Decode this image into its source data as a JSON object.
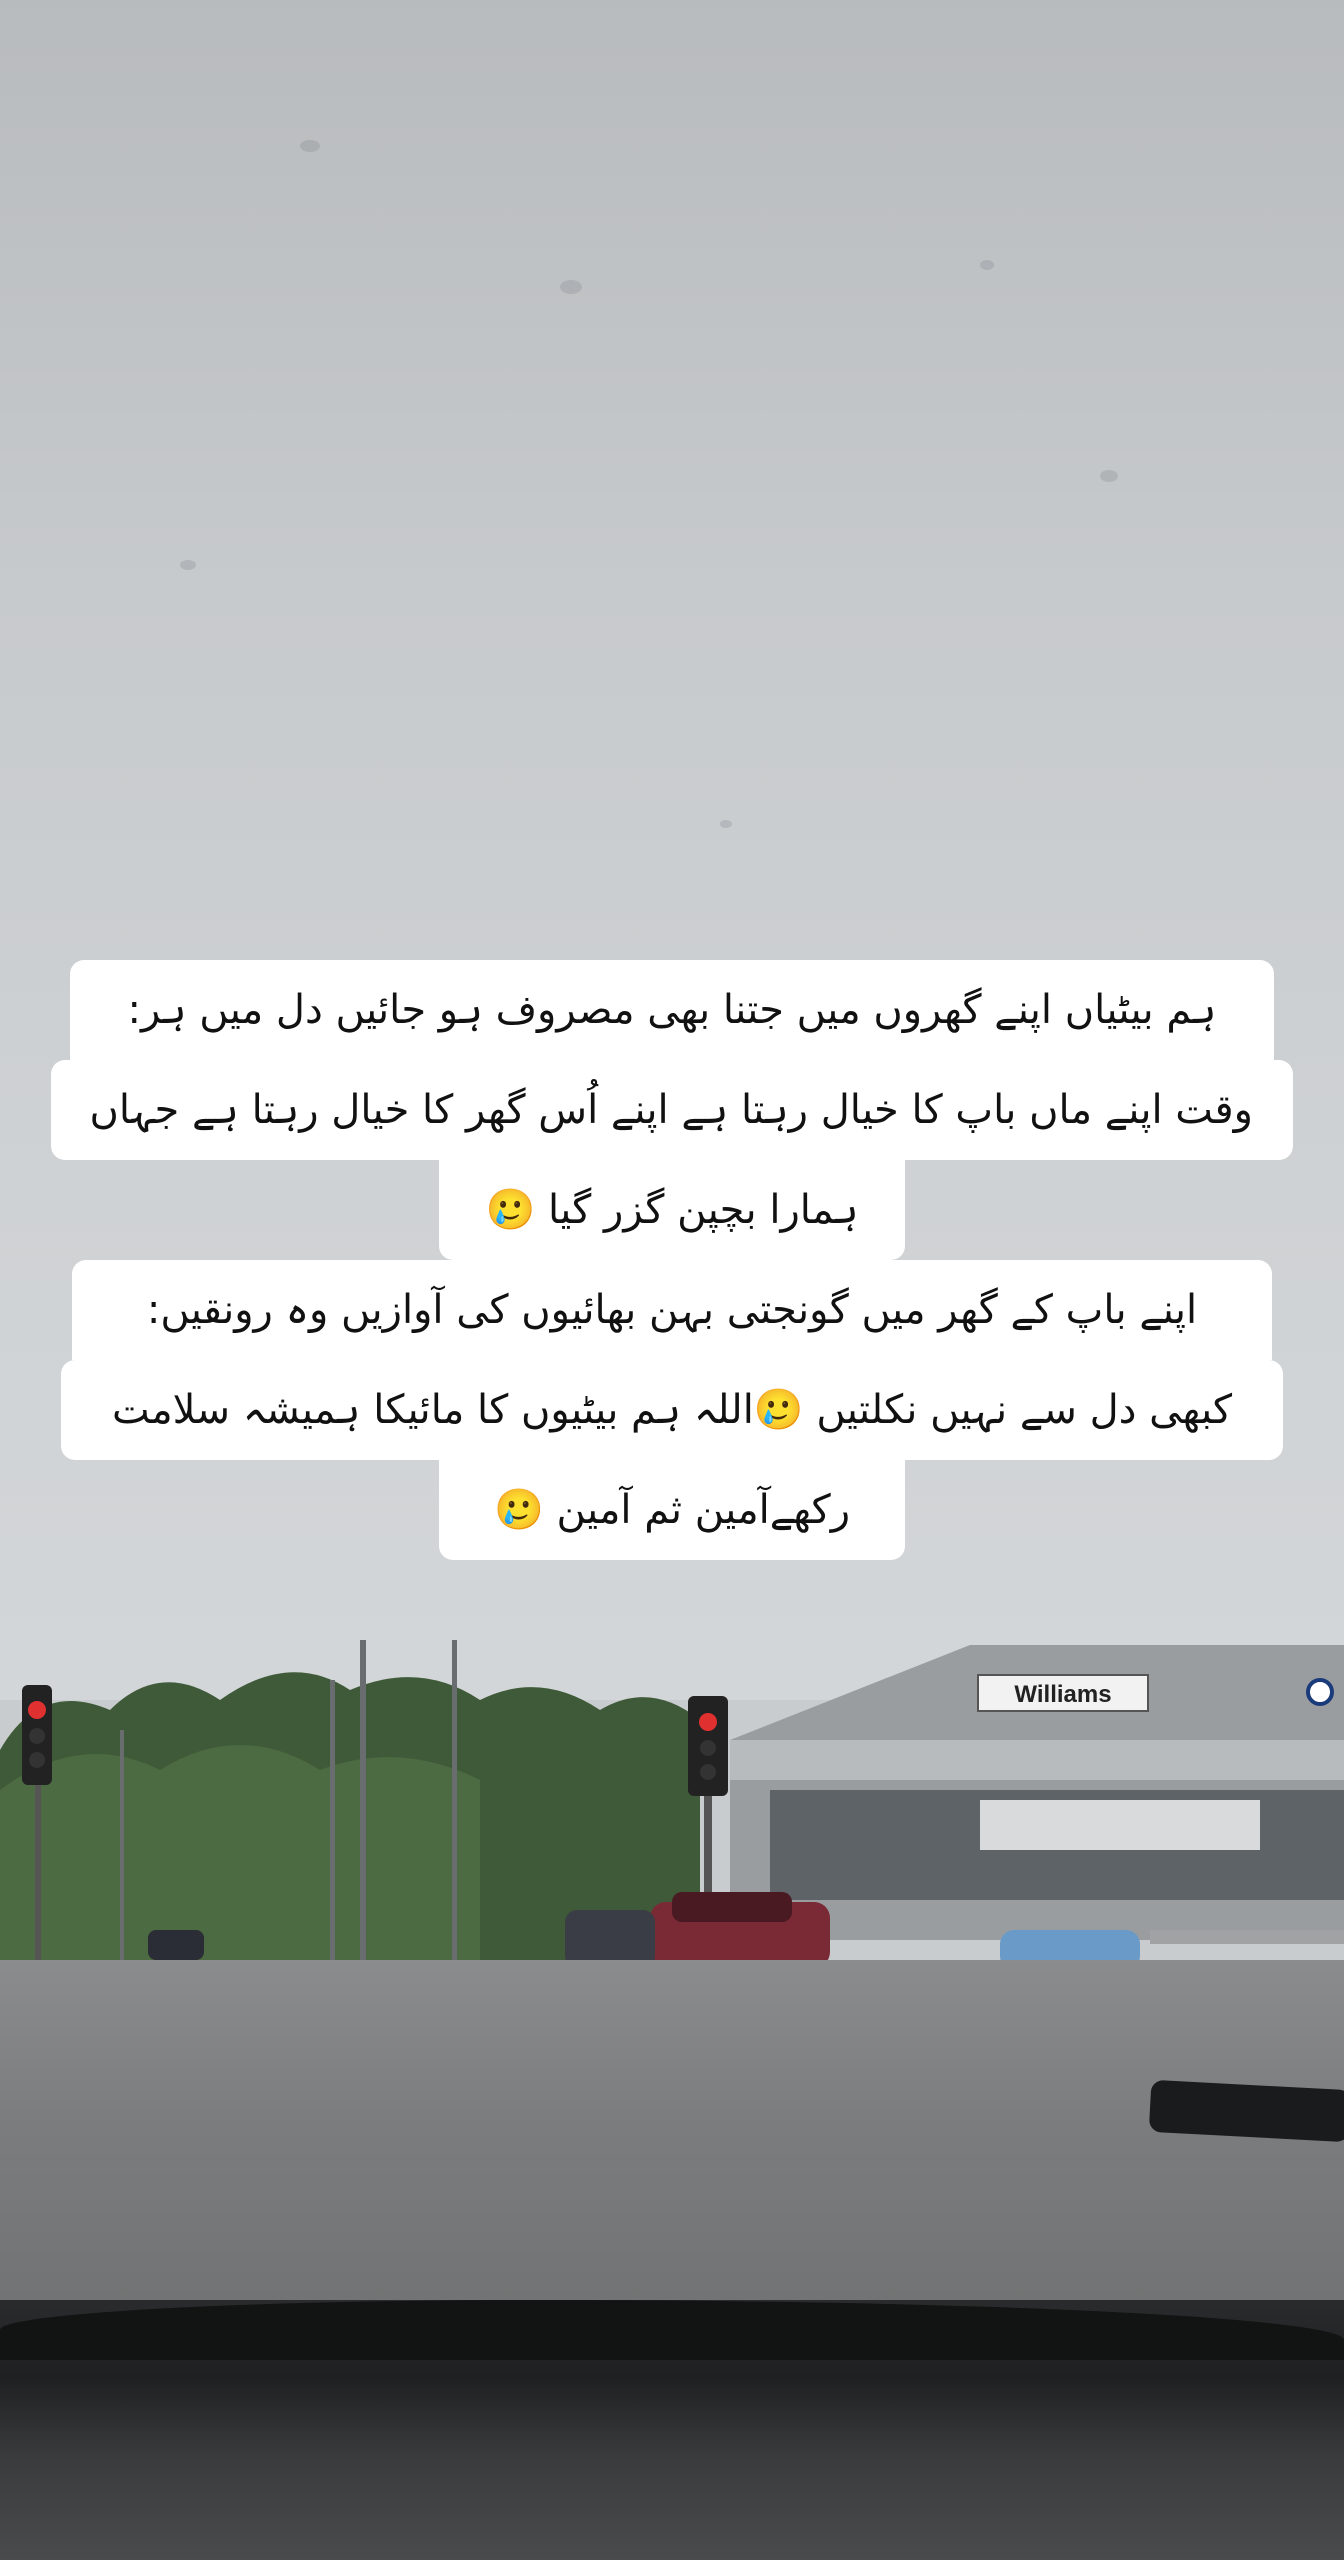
{
  "caption": {
    "lines": [
      "ہم بیٹیاں اپنے گھروں میں جتنا بھی مصروف ہو جائیں دل میں ہر:",
      "وقت اپنے ماں باپ کا خیال رہتا ہے اپنے اُس گھر کا خیال رہتا ہے جہاں",
      "ہمارا بچپن گزر گیا 🥲",
      "اپنے باپ کے گھر میں گونجتی بہن بھائیوں کی آوازیں وہ رونقیں:",
      "کبھی دل سے نہیں نکلتیں 🥲اللہ ہم بیٹیوں کا مائیکا ہمیشہ سلامت",
      "رکھےآمین ثم آمین 🥲"
    ]
  },
  "scene": {
    "storefront_sign": "Williams",
    "sky_color": "#c9ccce"
  }
}
